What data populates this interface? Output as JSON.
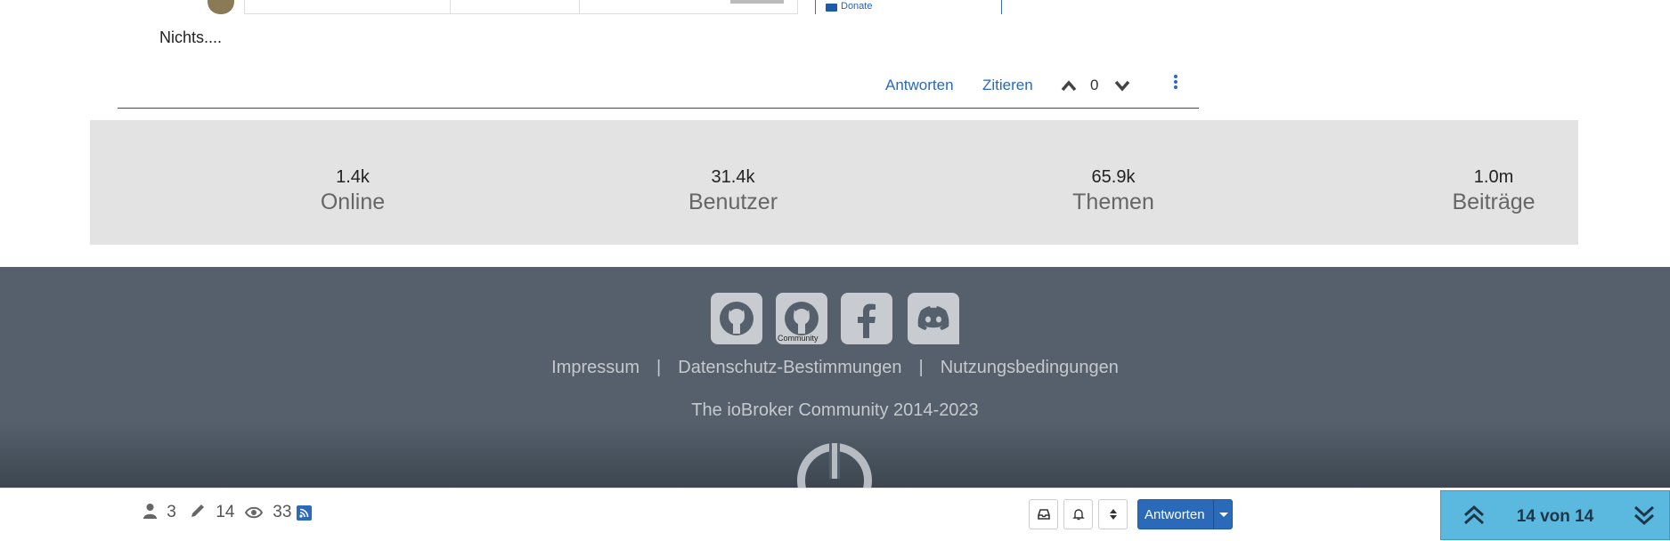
{
  "post": {
    "donate_label": "Donate",
    "body_text": "Nichts....",
    "actions": {
      "reply": "Antworten",
      "quote": "Zitieren",
      "votes": "0"
    }
  },
  "stats": [
    {
      "value": "1.4k",
      "label": "Online"
    },
    {
      "value": "31.4k",
      "label": "Benutzer"
    },
    {
      "value": "65.9k",
      "label": "Themen"
    },
    {
      "value": "1.0m",
      "label": "Beiträge"
    }
  ],
  "footer": {
    "social": [
      {
        "icon": "github-icon"
      },
      {
        "icon": "github-community-icon",
        "caption": "Community"
      },
      {
        "icon": "facebook-icon"
      },
      {
        "icon": "discord-icon"
      }
    ],
    "links": {
      "impressum": "Impressum",
      "datenschutz": "Datenschutz-Bestimmungen",
      "nutzung": "Nutzungsbedingungen",
      "separator": "|"
    },
    "copyright": "The ioBroker Community 2014-2023"
  },
  "topic_bar": {
    "posters": "3",
    "posts": "14",
    "views": "33",
    "reply_button": "Antworten",
    "pagination": "14 von 14"
  },
  "colors": {
    "accent": "#2a6ab8",
    "footer_bg": "#55606c",
    "stats_bg": "#e3e3e3",
    "pager_bg": "#5bb8de"
  }
}
